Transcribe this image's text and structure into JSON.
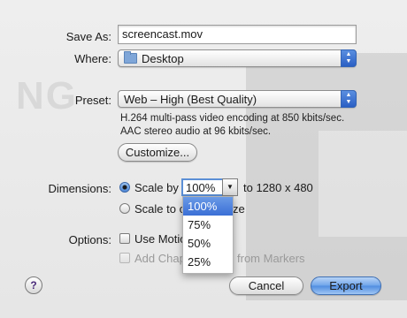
{
  "save_as": {
    "label": "Save As:",
    "value": "screencast.mov"
  },
  "where": {
    "label": "Where:",
    "value": "Desktop",
    "icon": "folder-icon"
  },
  "preset": {
    "label": "Preset:",
    "value": "Web – High (Best Quality)"
  },
  "preset_info": {
    "line1": "H.264 multi-pass video encoding at 850 kbits/sec.",
    "line2": "AAC stereo audio at 96 kbits/sec."
  },
  "customize_label": "Customize...",
  "dimensions": {
    "label": "Dimensions:",
    "scale_by_label": "Scale by",
    "scale_value": "100%",
    "to_text": "to 1280 x 480",
    "scale_to_label_part1": "Scale to c",
    "scale_to_label_part2": "ze",
    "menu_options": [
      "100%",
      "75%",
      "50%",
      "25%"
    ],
    "selected_option": "100%"
  },
  "options": {
    "label": "Options:",
    "use_motion_label": "Use Motio",
    "add_chapters_label_part1": "Add Chap",
    "add_chapters_label_part2": "from Markers"
  },
  "buttons": {
    "cancel": "Cancel",
    "export": "Export",
    "help": "?"
  },
  "background_text": "NG",
  "colors": {
    "accent": "#3a6fd6",
    "default_button": "#6ea4ea"
  }
}
